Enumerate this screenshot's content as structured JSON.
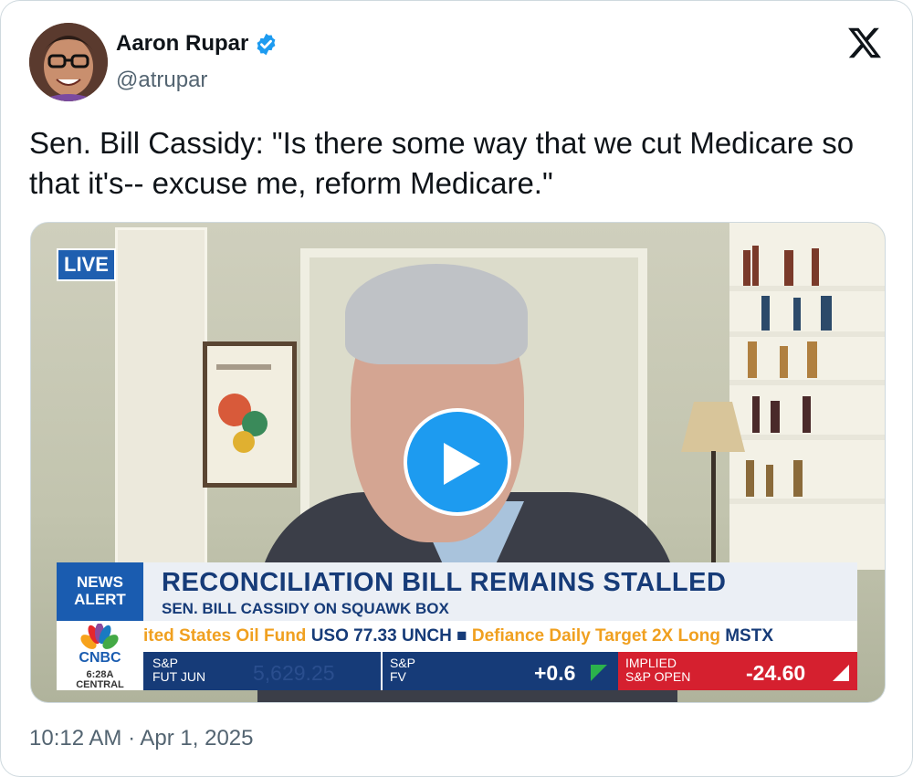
{
  "author": {
    "name": "Aaron Rupar",
    "handle": "@atrupar",
    "verified_color": "#1d9bf0"
  },
  "platform_icon": "x-logo-icon",
  "tweet": {
    "text": "Sen. Bill Cassidy: \"Is there some way that we cut Medicare so that it's-- excuse me, reform Medicare.\"",
    "timestamp": "10:12 AM · Apr 1, 2025"
  },
  "video": {
    "live_badge": "LIVE",
    "alert_label_1": "NEWS",
    "alert_label_2": "ALERT",
    "headline": "RECONCILIATION BILL REMAINS STALLED",
    "subheadline": "SEN. BILL CASSIDY ON SQUAWK BOX",
    "network": "CNBC",
    "local_time": "6:28A",
    "local_zone": "CENTRAL",
    "ticker_part1": "ited States Oil Fund ",
    "ticker_part2": "USO 77.33 UNCH ■",
    "ticker_part3": "  Defiance Daily Target 2X Long ",
    "ticker_part4": "MSTX",
    "market": {
      "cell1_line1": "S&P",
      "cell1_line2": "FUT JUN",
      "cell1_value": "5,629.25",
      "cell2_line1": "S&P",
      "cell2_line2": "FV",
      "cell2_value": "+0.6",
      "cell3_line1": "IMPLIED",
      "cell3_line2": "S&P OPEN",
      "cell3_value": "-24.60"
    },
    "play_icon": "play-icon"
  }
}
